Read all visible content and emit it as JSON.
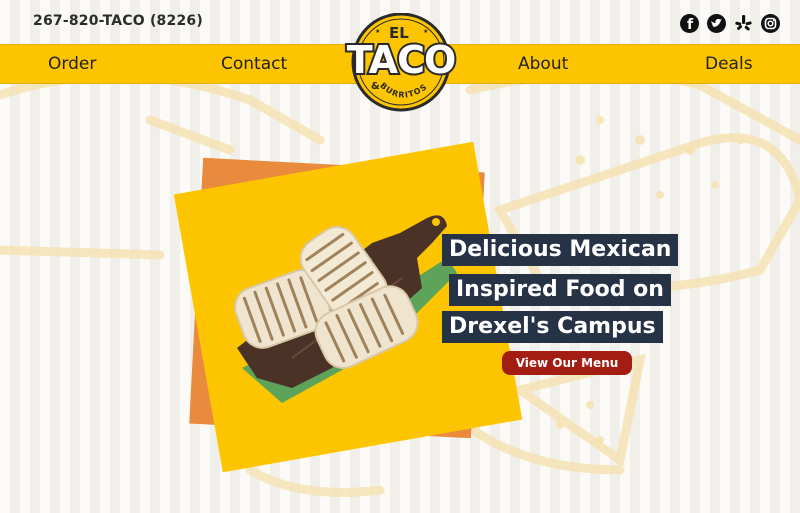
{
  "header": {
    "phone": "267-820-TACO (8226)",
    "social": [
      "facebook-icon",
      "twitter-icon",
      "yelp-icon",
      "instagram-icon"
    ]
  },
  "nav": {
    "items": [
      "Order",
      "Contact",
      "About",
      "Deals"
    ]
  },
  "logo": {
    "top": "EL",
    "main": "TACO",
    "amp": "&",
    "sub": "BURRITOS"
  },
  "hero": {
    "headline_lines": [
      "Delicious Mexican",
      "Inspired Food on",
      "Drexel's Campus"
    ],
    "cta": "View Our Menu",
    "image": "grilled-burritos-on-cutting-board"
  },
  "colors": {
    "brand_yellow": "#fdc400",
    "accent_orange": "#ea8a3c",
    "headline_bg": "#263246",
    "button_red": "#a31d13"
  }
}
